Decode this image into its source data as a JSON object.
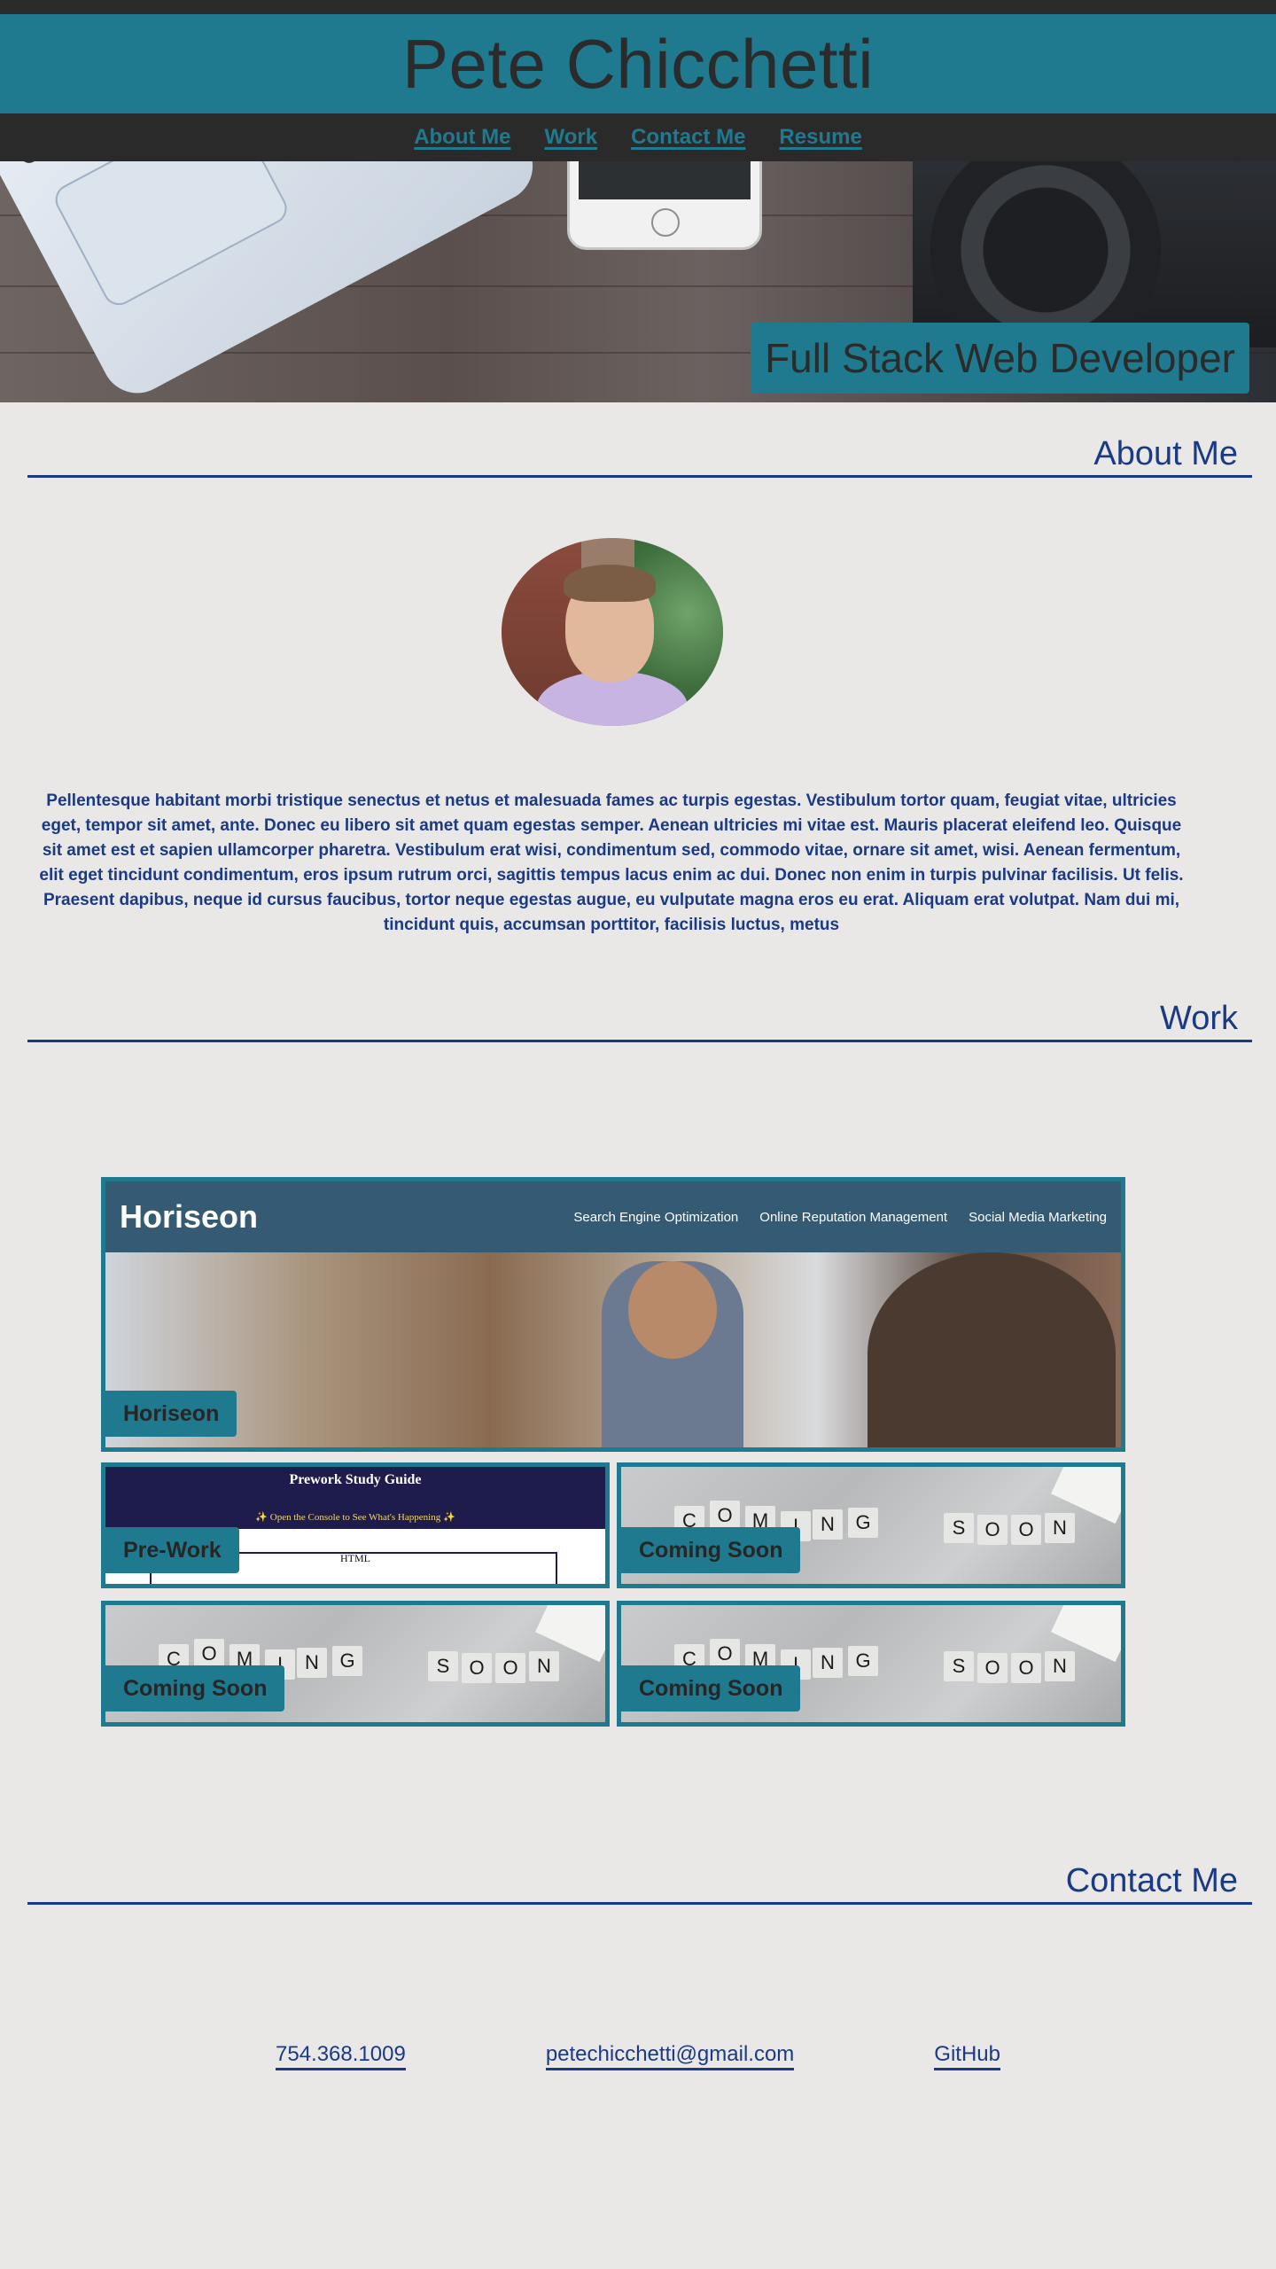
{
  "header": {
    "title": "Pete Chicchetti"
  },
  "nav": {
    "items": [
      "About Me",
      "Work",
      "Contact Me",
      "Resume"
    ]
  },
  "hero": {
    "badge": "Full Stack Web Developer"
  },
  "about": {
    "heading": "About Me",
    "text": "Pellentesque habitant morbi tristique senectus et netus et malesuada fames ac turpis egestas. Vestibulum tortor quam, feugiat vitae, ultricies eget, tempor sit amet, ante. Donec eu libero sit amet quam egestas semper. Aenean ultricies mi vitae est. Mauris placerat eleifend leo. Quisque sit amet est et sapien ullamcorper pharetra. Vestibulum erat wisi, condimentum sed, commodo vitae, ornare sit amet, wisi. Aenean fermentum, elit eget tincidunt condimentum, eros ipsum rutrum orci, sagittis tempus lacus enim ac dui. Donec non enim in turpis pulvinar facilisis. Ut felis. Praesent dapibus, neque id cursus faucibus, tortor neque egestas augue, eu vulputate magna eros eu erat. Aliquam erat volutpat. Nam dui mi, tincidunt quis, accumsan porttitor, facilisis luctus, metus"
  },
  "work": {
    "heading": "Work",
    "tiles": [
      {
        "label": "Horiseon",
        "screenshot": {
          "brand": "Horiseon",
          "links": [
            "Search Engine Optimization",
            "Online Reputation Management",
            "Social Media Marketing"
          ]
        }
      },
      {
        "label": "Pre-Work",
        "screenshot": {
          "title": "Prework Study Guide",
          "subtitle": "✨ Open the Console to See What's Happening ✨",
          "section": "HTML"
        }
      },
      {
        "label": "Coming Soon"
      },
      {
        "label": "Coming Soon"
      },
      {
        "label": "Coming Soon"
      }
    ]
  },
  "contact": {
    "heading": "Contact Me",
    "phone": "754.368.1009",
    "email": "petechicchetti@gmail.com",
    "github": "GitHub"
  },
  "colors": {
    "teal": "#1f7a8f",
    "navy": "#1a3a86",
    "dark": "#2a2a2a",
    "background": "#e9e8e7"
  }
}
